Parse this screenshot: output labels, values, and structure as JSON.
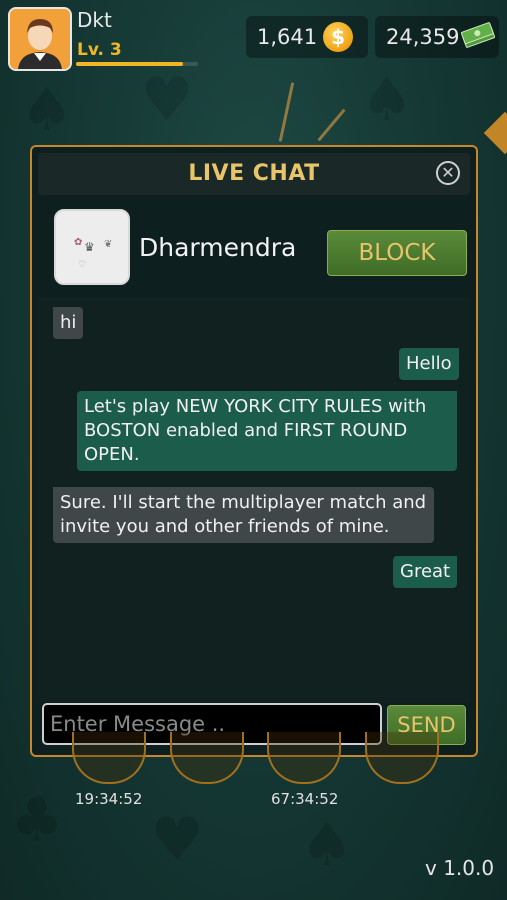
{
  "player": {
    "name": "Dkt",
    "level_label": "Lv.",
    "level_value": "3",
    "xp_fraction": 0.88
  },
  "currency": {
    "coins": "1,641",
    "coin_symbol": "$",
    "cash": "24,359"
  },
  "chat": {
    "title": "LIVE CHAT",
    "friend_name": "Dharmendra",
    "block_label": "BLOCK",
    "messages": [
      {
        "from": "friend",
        "text": "hi"
      },
      {
        "from": "me",
        "text": "Hello"
      },
      {
        "from": "me",
        "text": "Let's play NEW YORK CITY RULES with BOSTON enabled and FIRST ROUND OPEN."
      },
      {
        "from": "friend",
        "text": "Sure. I'll start the multiplayer match and invite you and other friends of mine."
      },
      {
        "from": "me",
        "text": "Great"
      }
    ],
    "input_placeholder": "Enter Message ..",
    "send_label": "SEND"
  },
  "timers": [
    "19:34:52",
    "67:34:52"
  ],
  "version": "v 1.0.0",
  "colors": {
    "accent_gold": "#e8c46a",
    "border_orange": "#c8862a",
    "button_green": "#4a7b30",
    "outgoing_bubble": "#1c5c4b",
    "incoming_bubble": "#3f4749"
  }
}
